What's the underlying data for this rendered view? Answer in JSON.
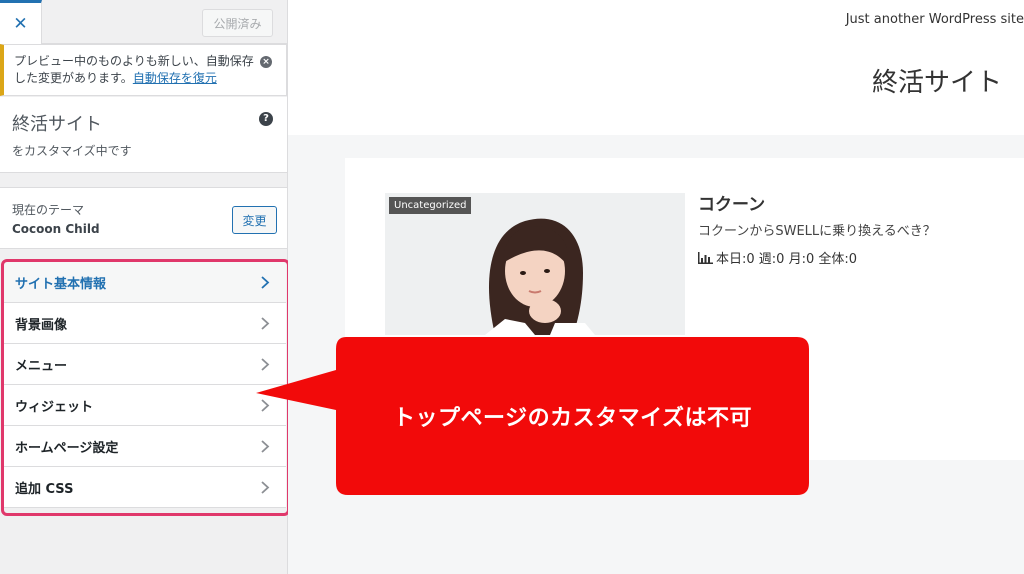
{
  "sidebar": {
    "close_glyph": "✕",
    "publish_label": "公開済み",
    "notice": {
      "text": "プレビュー中のものよりも新しい、自動保存した変更があります。",
      "link": "自動保存を復元"
    },
    "site": {
      "title": "終活サイト",
      "subtitle": "をカスタマイズ中です"
    },
    "theme": {
      "caption": "現在のテーマ",
      "name": "Cocoon Child",
      "change_label": "変更"
    },
    "menu": [
      {
        "label": "サイト基本情報",
        "active": true
      },
      {
        "label": "背景画像",
        "active": false
      },
      {
        "label": "メニュー",
        "active": false
      },
      {
        "label": "ウィジェット",
        "active": false
      },
      {
        "label": "ホームページ設定",
        "active": false
      },
      {
        "label": "追加 CSS",
        "active": false
      }
    ]
  },
  "preview": {
    "tagline": "Just another WordPress site",
    "title": "終活サイト",
    "post": {
      "category": "Uncategorized",
      "title": "コクーン",
      "excerpt": "コクーンからSWELLに乗り換えるべき？",
      "stats": "本日:0  週:0  月:0  全体:0"
    }
  },
  "callout": {
    "text": "トップページのカスタマイズは不可",
    "color": "#f20a0a"
  },
  "colors": {
    "accent": "#2271b1",
    "highlight": "#e0386b",
    "notice_border": "#dba617"
  },
  "icons": {
    "close": "close-icon",
    "dismiss": "dismiss-icon",
    "help": "help-icon",
    "chevron": "chevron-right-icon",
    "stats": "bar-chart-icon"
  }
}
